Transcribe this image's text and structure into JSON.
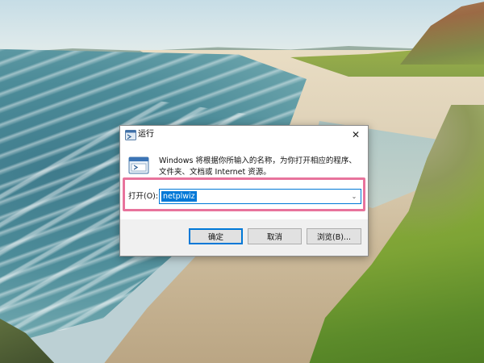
{
  "dialog": {
    "title": "运行",
    "close_symbol": "✕",
    "description": "Windows 将根据你所输入的名称，为你打开相应的程序、文件夹、文档或 Internet 资源。",
    "open_label": "打开(O):",
    "command_value": "netplwiz",
    "dropdown_symbol": "⌄",
    "buttons": {
      "ok": "确定",
      "cancel": "取消",
      "browse": "浏览(B)..."
    }
  },
  "colors": {
    "accent": "#0078d7",
    "highlight_border": "#e8739c"
  },
  "icons": {
    "title": "run-app-icon",
    "body": "run-dialog-icon",
    "close": "close-icon",
    "dropdown": "chevron-down-icon"
  }
}
